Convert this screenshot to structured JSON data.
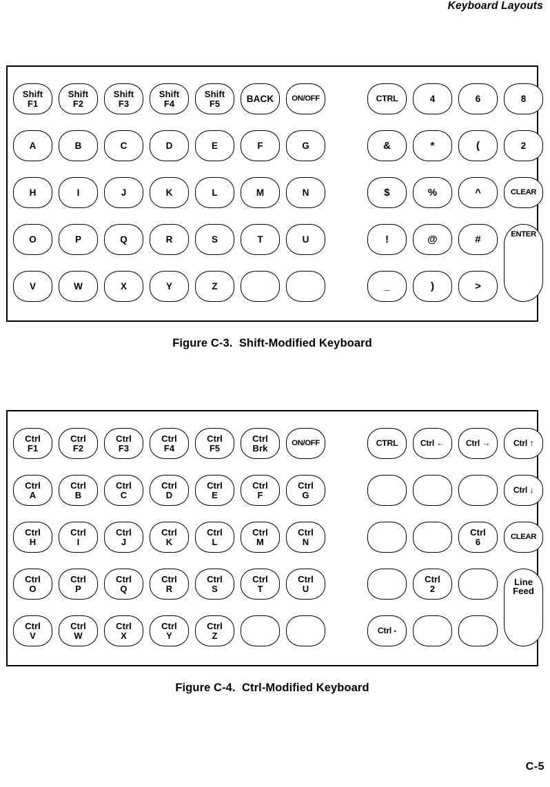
{
  "running_head": "Keyboard Layouts",
  "page_number": "C-5",
  "figures": [
    {
      "id": "figure-c3",
      "caption": "Figure C-3.  Shift-Modified Keyboard",
      "rows": [
        {
          "main": [
            {
              "lines": [
                "Shift",
                "F1"
              ]
            },
            {
              "lines": [
                "Shift",
                "F2"
              ]
            },
            {
              "lines": [
                "Shift",
                "F3"
              ]
            },
            {
              "lines": [
                "Shift",
                "F4"
              ]
            },
            {
              "lines": [
                "Shift",
                "F5"
              ]
            },
            {
              "lines": [
                "BACK"
              ]
            },
            {
              "lines": [
                "ON/OFF"
              ],
              "size": "tiny"
            }
          ],
          "pad": [
            {
              "lines": [
                "CTRL"
              ],
              "size": "small"
            },
            {
              "lines": [
                "4"
              ]
            },
            {
              "lines": [
                "6"
              ]
            },
            {
              "lines": [
                "8"
              ]
            }
          ]
        },
        {
          "main": [
            {
              "lines": [
                "A"
              ]
            },
            {
              "lines": [
                "B"
              ]
            },
            {
              "lines": [
                "C"
              ]
            },
            {
              "lines": [
                "D"
              ]
            },
            {
              "lines": [
                "E"
              ]
            },
            {
              "lines": [
                "F"
              ]
            },
            {
              "lines": [
                "G"
              ]
            }
          ],
          "pad": [
            {
              "lines": [
                "&"
              ],
              "size": "sym"
            },
            {
              "lines": [
                "*"
              ],
              "size": "sym"
            },
            {
              "lines": [
                "("
              ],
              "size": "sym"
            },
            {
              "lines": [
                "2"
              ]
            }
          ]
        },
        {
          "main": [
            {
              "lines": [
                "H"
              ]
            },
            {
              "lines": [
                "I"
              ]
            },
            {
              "lines": [
                "J"
              ]
            },
            {
              "lines": [
                "K"
              ]
            },
            {
              "lines": [
                "L"
              ]
            },
            {
              "lines": [
                "M"
              ]
            },
            {
              "lines": [
                "N"
              ]
            }
          ],
          "pad": [
            {
              "lines": [
                "$"
              ],
              "size": "sym"
            },
            {
              "lines": [
                "%"
              ],
              "size": "sym"
            },
            {
              "lines": [
                "^"
              ],
              "size": "sym"
            },
            {
              "lines": [
                "CLEAR"
              ],
              "size": "tiny"
            }
          ]
        },
        {
          "main": [
            {
              "lines": [
                "O"
              ]
            },
            {
              "lines": [
                "P"
              ]
            },
            {
              "lines": [
                "Q"
              ]
            },
            {
              "lines": [
                "R"
              ]
            },
            {
              "lines": [
                "S"
              ]
            },
            {
              "lines": [
                "T"
              ]
            },
            {
              "lines": [
                "U"
              ]
            }
          ],
          "pad": [
            {
              "lines": [
                "!"
              ],
              "size": "sym"
            },
            {
              "lines": [
                "@"
              ],
              "size": "sym"
            },
            {
              "lines": [
                "#"
              ],
              "size": "sym"
            },
            {
              "lines": [
                "ENTER"
              ],
              "size": "tiny",
              "tall": true
            }
          ]
        },
        {
          "main": [
            {
              "lines": [
                "V"
              ]
            },
            {
              "lines": [
                "W"
              ]
            },
            {
              "lines": [
                "X"
              ]
            },
            {
              "lines": [
                "Y"
              ]
            },
            {
              "lines": [
                "Z"
              ]
            },
            {
              "lines": [
                ""
              ],
              "blank": true
            },
            {
              "lines": [
                ""
              ],
              "blank": true
            }
          ],
          "pad": [
            {
              "lines": [
                "_"
              ],
              "size": "sym"
            },
            {
              "lines": [
                ")"
              ],
              "size": "sym"
            },
            {
              "lines": [
                ">"
              ],
              "size": "sym"
            }
          ]
        }
      ]
    },
    {
      "id": "figure-c4",
      "caption": "Figure C-4.  Ctrl-Modified Keyboard",
      "rows": [
        {
          "main": [
            {
              "lines": [
                "Ctrl",
                "F1"
              ]
            },
            {
              "lines": [
                "Ctrl",
                "F2"
              ]
            },
            {
              "lines": [
                "Ctrl",
                "F3"
              ]
            },
            {
              "lines": [
                "Ctrl",
                "F4"
              ]
            },
            {
              "lines": [
                "Ctrl",
                "F5"
              ]
            },
            {
              "lines": [
                "Ctrl",
                "Brk"
              ]
            },
            {
              "lines": [
                "ON/OFF"
              ],
              "size": "tiny"
            }
          ],
          "pad": [
            {
              "lines": [
                "CTRL"
              ],
              "size": "small"
            },
            {
              "lines": [
                "Ctrl ←"
              ],
              "size": "small"
            },
            {
              "lines": [
                "Ctrl →"
              ],
              "size": "small"
            },
            {
              "lines": [
                "Ctrl ↑"
              ],
              "size": "small"
            }
          ]
        },
        {
          "main": [
            {
              "lines": [
                "Ctrl",
                "A"
              ]
            },
            {
              "lines": [
                "Ctrl",
                "B"
              ]
            },
            {
              "lines": [
                "Ctrl",
                "C"
              ]
            },
            {
              "lines": [
                "Ctrl",
                "D"
              ]
            },
            {
              "lines": [
                "Ctrl",
                "E"
              ]
            },
            {
              "lines": [
                "Ctrl",
                "F"
              ]
            },
            {
              "lines": [
                "Ctrl",
                "G"
              ]
            }
          ],
          "pad": [
            {
              "lines": [
                ""
              ],
              "blank": true
            },
            {
              "lines": [
                ""
              ],
              "blank": true
            },
            {
              "lines": [
                ""
              ],
              "blank": true
            },
            {
              "lines": [
                "Ctrl ↓"
              ],
              "size": "small"
            }
          ]
        },
        {
          "main": [
            {
              "lines": [
                "Ctrl",
                "H"
              ]
            },
            {
              "lines": [
                "Ctrl",
                "I"
              ]
            },
            {
              "lines": [
                "Ctrl",
                "J"
              ]
            },
            {
              "lines": [
                "Ctrl",
                "K"
              ]
            },
            {
              "lines": [
                "Ctrl",
                "L"
              ]
            },
            {
              "lines": [
                "Ctrl",
                "M"
              ]
            },
            {
              "lines": [
                "Ctrl",
                "N"
              ]
            }
          ],
          "pad": [
            {
              "lines": [
                ""
              ],
              "blank": true
            },
            {
              "lines": [
                ""
              ],
              "blank": true
            },
            {
              "lines": [
                "Ctrl",
                "6"
              ]
            },
            {
              "lines": [
                "CLEAR"
              ],
              "size": "tiny"
            }
          ]
        },
        {
          "main": [
            {
              "lines": [
                "Ctrl",
                "O"
              ]
            },
            {
              "lines": [
                "Ctrl",
                "P"
              ]
            },
            {
              "lines": [
                "Ctrl",
                "Q"
              ]
            },
            {
              "lines": [
                "Ctrl",
                "R"
              ]
            },
            {
              "lines": [
                "Ctrl",
                "S"
              ]
            },
            {
              "lines": [
                "Ctrl",
                "T"
              ]
            },
            {
              "lines": [
                "Ctrl",
                "U"
              ]
            }
          ],
          "pad": [
            {
              "lines": [
                ""
              ],
              "blank": true
            },
            {
              "lines": [
                "Ctrl",
                "2"
              ]
            },
            {
              "lines": [
                ""
              ],
              "blank": true
            },
            {
              "lines": [
                "Line",
                "Feed"
              ],
              "tall": true
            }
          ]
        },
        {
          "main": [
            {
              "lines": [
                "Ctrl",
                "V"
              ]
            },
            {
              "lines": [
                "Ctrl",
                "W"
              ]
            },
            {
              "lines": [
                "Ctrl",
                "X"
              ]
            },
            {
              "lines": [
                "Ctrl",
                "Y"
              ]
            },
            {
              "lines": [
                "Ctrl",
                "Z"
              ]
            },
            {
              "lines": [
                ""
              ],
              "blank": true
            },
            {
              "lines": [
                ""
              ],
              "blank": true
            }
          ],
          "pad": [
            {
              "lines": [
                "Ctrl -"
              ],
              "size": "small"
            },
            {
              "lines": [
                ""
              ],
              "blank": true
            },
            {
              "lines": [
                ""
              ],
              "blank": true
            }
          ]
        }
      ]
    }
  ]
}
